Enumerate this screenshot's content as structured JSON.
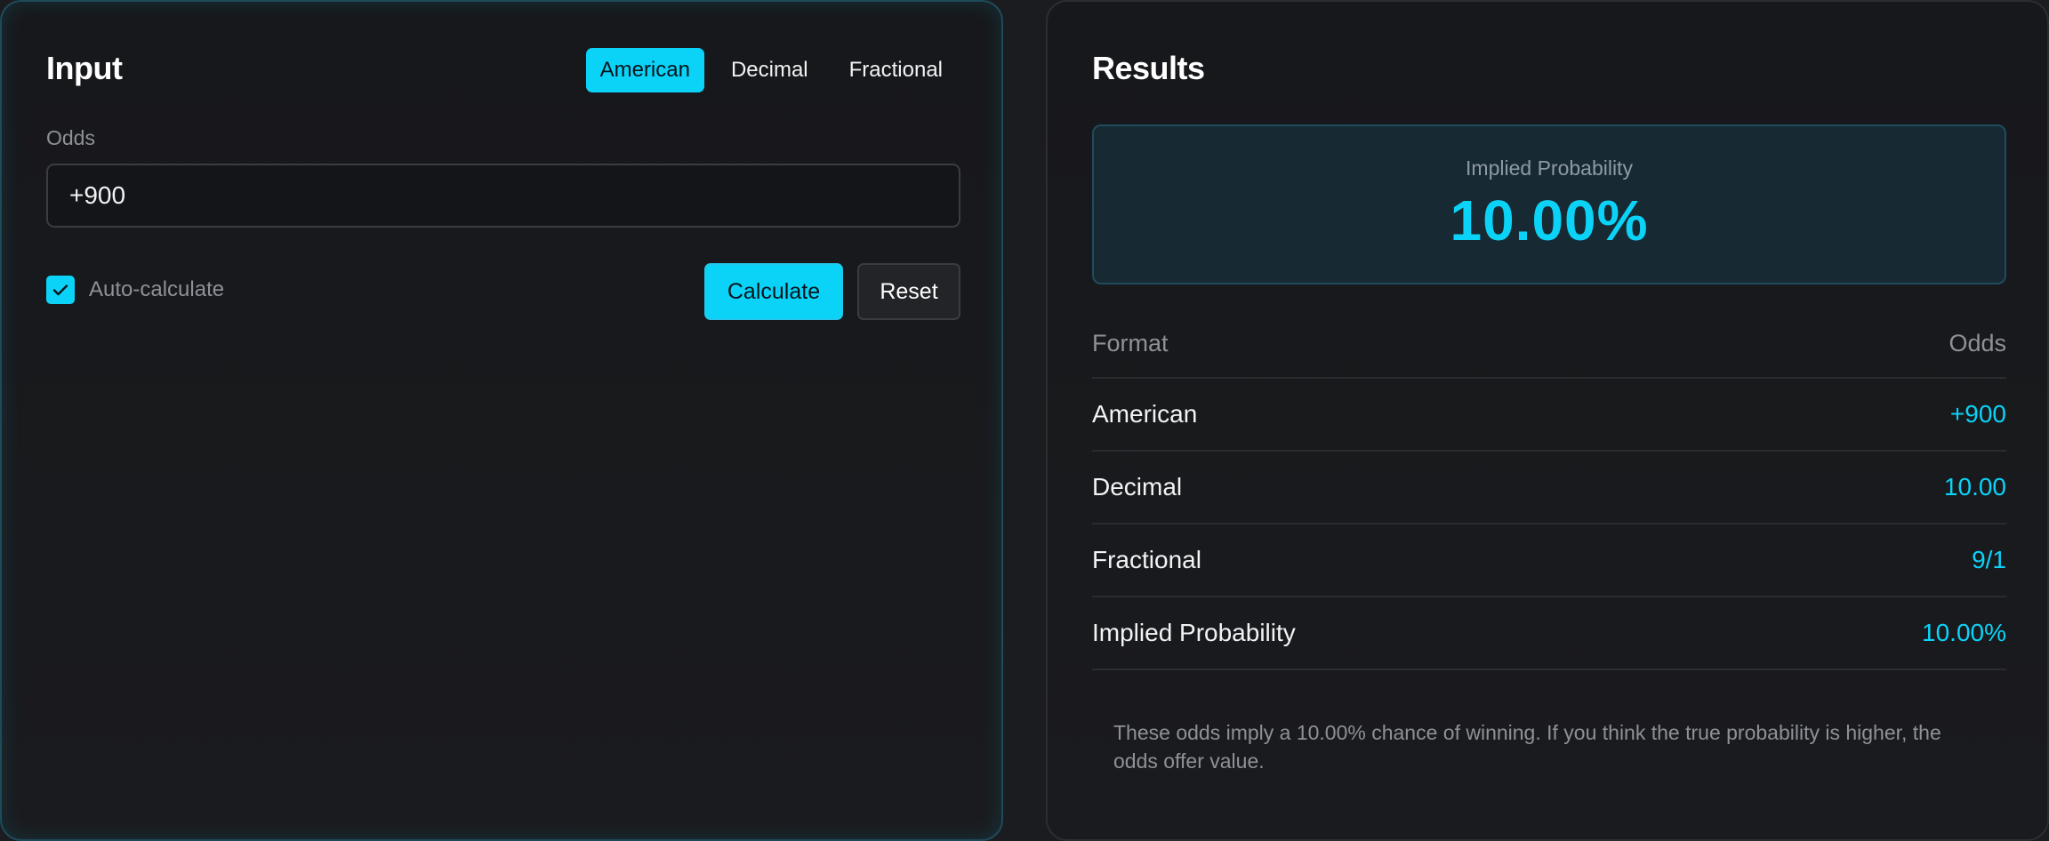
{
  "input": {
    "title": "Input",
    "tabs": [
      {
        "label": "American",
        "active": true
      },
      {
        "label": "Decimal",
        "active": false
      },
      {
        "label": "Fractional",
        "active": false
      }
    ],
    "odds_label": "Odds",
    "odds_value": "+900",
    "auto_calculate": {
      "label": "Auto-calculate",
      "checked": true
    },
    "calculate_label": "Calculate",
    "reset_label": "Reset"
  },
  "results": {
    "title": "Results",
    "probability_label": "Implied Probability",
    "probability_value": "10.00%",
    "table": {
      "headers": [
        "Format",
        "Odds"
      ],
      "rows": [
        {
          "format": "American",
          "odds": "+900"
        },
        {
          "format": "Decimal",
          "odds": "10.00"
        },
        {
          "format": "Fractional",
          "odds": "9/1"
        },
        {
          "format": "Implied Probability",
          "odds": "10.00%"
        }
      ]
    },
    "note": "These odds imply a 10.00% chance of winning. If you think the true probability is higher, the odds offer value."
  },
  "colors": {
    "accent": "#0bd3f8",
    "background": "#1b1c1f",
    "panel": "#17181b",
    "muted_text": "#8e9198"
  },
  "icons": {
    "checkbox": "checkmark-icon"
  }
}
